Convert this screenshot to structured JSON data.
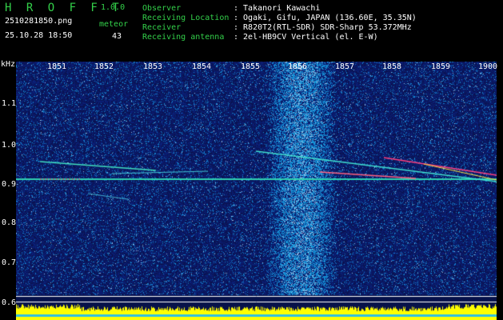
{
  "app": {
    "title": "H R O F F T",
    "version": "1.0.0",
    "filename": "2510281850.png",
    "datetime": "25.10.28 18:50",
    "meteor_label": "meteor",
    "meteor_count": "43"
  },
  "info": [
    {
      "label": "Observer",
      "value": ": Takanori Kawachi"
    },
    {
      "label": "Receiving Location",
      "value": ": Ogaki, Gifu, JAPAN (136.60E, 35.35N)"
    },
    {
      "label": "Receiver",
      "value": ": R820T2(RTL-SDR) SDR-Sharp 53.372MHz"
    },
    {
      "label": "Receiving antenna",
      "value": ": 2el-HB9CV Vertical (el. E-W)"
    }
  ],
  "axis": {
    "unit": "kHz",
    "time_ticks": [
      "1851",
      "1852",
      "1853",
      "1854",
      "1855",
      "1856",
      "1857",
      "1858",
      "1859",
      "1900"
    ],
    "freq_ticks": [
      "1.1",
      "1.0",
      "0.9",
      "0.8",
      "0.7",
      "0.6"
    ]
  },
  "colors": {
    "background": "#000000",
    "header_green": "#33d04a",
    "header_white": "#ffffff",
    "noise_floor": "#0f1f7a",
    "carrier": "#28c0a0",
    "signal_bar": "#ffff00"
  }
}
